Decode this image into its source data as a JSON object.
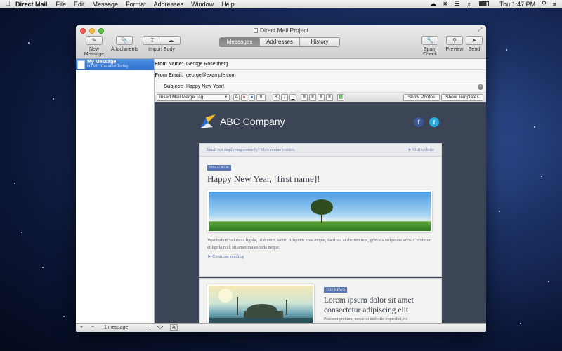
{
  "menubar": {
    "app_name": "Direct Mail",
    "items": [
      "File",
      "Edit",
      "Message",
      "Format",
      "Addresses",
      "Window",
      "Help"
    ],
    "clock": "Thu 1:47 PM"
  },
  "window": {
    "title": "Direct Mail Project",
    "toolbar": {
      "new_message": "New Message",
      "attachments": "Attachments",
      "import_body": "Import Body",
      "spam_check": "Spam Check",
      "preview": "Preview",
      "send": "Send"
    },
    "tabs": [
      {
        "label": "Messages",
        "active": true
      },
      {
        "label": "Addresses",
        "active": false
      },
      {
        "label": "History",
        "active": false
      }
    ]
  },
  "sidebar": {
    "messages": [
      {
        "title": "My Message",
        "subtitle": "HTML, Created Today"
      }
    ],
    "count_label": "1 message"
  },
  "fields": {
    "from_name_label": "From Name:",
    "from_name_value": "George Rosenberg",
    "from_email_label": "From Email:",
    "from_email_value": "george@example.com",
    "subject_label": "Subject:",
    "subject_value": "Happy New Year!"
  },
  "format_bar": {
    "merge_tag_placeholder": "Insert Mail Merge Tag...",
    "show_photos": "Show Photos",
    "show_templates": "Show Templates"
  },
  "email": {
    "logo_text": "ABC Company",
    "header_left": "Email not displaying correctly? View online version.",
    "header_right": "Visit website",
    "issue_badge": "ISSUE #536",
    "headline": "Happy New Year, [first name]!",
    "body": "Vestibulum vel risus ligula, id dictum lacus. Aliquam eros neque, facilisis at dictum non, gravida vulputate arcu. Curabitur et ligula nisl, sit amet malesuada neque.",
    "continue": "Continue reading",
    "top_news_badge": "TOP NEWS",
    "article2_title": "Lorem ipsum dolor sit amet consectetur adipiscing elit",
    "article2_body": "Praesent pretium, neque ut molestie imperdiet, mi"
  },
  "colors": {
    "accent_blue": "#2e6ed0",
    "canvas_bg": "#3c4555",
    "badge": "#5876b6"
  }
}
